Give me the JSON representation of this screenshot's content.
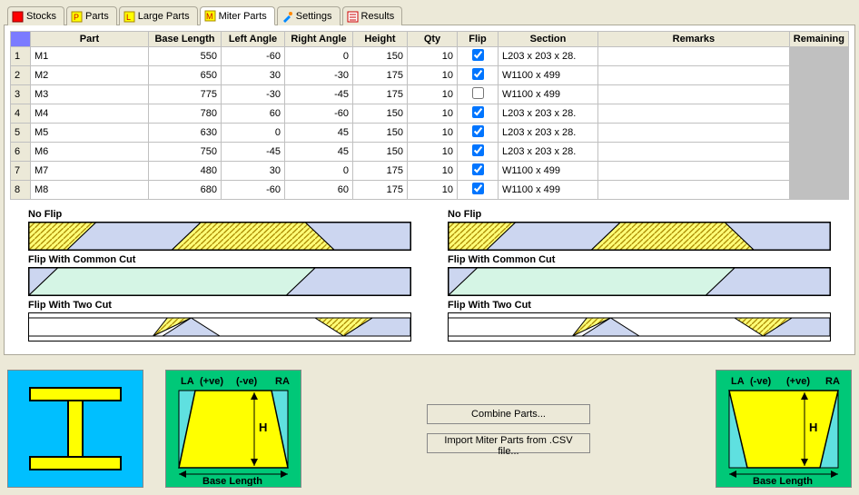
{
  "tabs": {
    "stocks": "Stocks",
    "parts": "Parts",
    "large_parts": "Large Parts",
    "miter_parts": "Miter Parts",
    "settings": "Settings",
    "results": "Results",
    "active": "miter_parts"
  },
  "table": {
    "headers": {
      "part": "Part",
      "base_length": "Base Length",
      "left_angle": "Left Angle",
      "right_angle": "Right Angle",
      "height": "Height",
      "qty": "Qty",
      "flip": "Flip",
      "section": "Section",
      "remarks": "Remarks",
      "remaining": "Remaining"
    },
    "rows": [
      {
        "n": "1",
        "part": "M1",
        "base": 550,
        "la": -60,
        "ra": 0,
        "h": 150,
        "qty": 10,
        "flip": true,
        "section": "L203 x 203 x 28.",
        "remarks": ""
      },
      {
        "n": "2",
        "part": "M2",
        "base": 650,
        "la": 30,
        "ra": -30,
        "h": 175,
        "qty": 10,
        "flip": true,
        "section": "W1100 x 499",
        "remarks": ""
      },
      {
        "n": "3",
        "part": "M3",
        "base": 775,
        "la": -30,
        "ra": -45,
        "h": 175,
        "qty": 10,
        "flip": false,
        "section": "W1100 x 499",
        "remarks": ""
      },
      {
        "n": "4",
        "part": "M4",
        "base": 780,
        "la": 60,
        "ra": -60,
        "h": 150,
        "qty": 10,
        "flip": true,
        "section": "L203 x 203 x 28.",
        "remarks": ""
      },
      {
        "n": "5",
        "part": "M5",
        "base": 630,
        "la": 0,
        "ra": 45,
        "h": 150,
        "qty": 10,
        "flip": true,
        "section": "L203 x 203 x 28.",
        "remarks": ""
      },
      {
        "n": "6",
        "part": "M6",
        "base": 750,
        "la": -45,
        "ra": 45,
        "h": 150,
        "qty": 10,
        "flip": true,
        "section": "L203 x 203 x 28.",
        "remarks": ""
      },
      {
        "n": "7",
        "part": "M7",
        "base": 480,
        "la": 30,
        "ra": 0,
        "h": 175,
        "qty": 10,
        "flip": true,
        "section": "W1100 x 499",
        "remarks": ""
      },
      {
        "n": "8",
        "part": "M8",
        "base": 680,
        "la": -60,
        "ra": 60,
        "h": 175,
        "qty": 10,
        "flip": true,
        "section": "W1100 x 499",
        "remarks": ""
      }
    ]
  },
  "diagrams": {
    "no_flip": "No Flip",
    "flip_common": "Flip With Common Cut",
    "flip_two": "Flip With Two Cut"
  },
  "bottom": {
    "la": "LA",
    "ra": "RA",
    "pve": "(+ve)",
    "nve": "(-ve)",
    "h": "H",
    "base_length": "Base Length",
    "combine": "Combine Parts...",
    "import": "Import Miter Parts from .CSV file..."
  }
}
